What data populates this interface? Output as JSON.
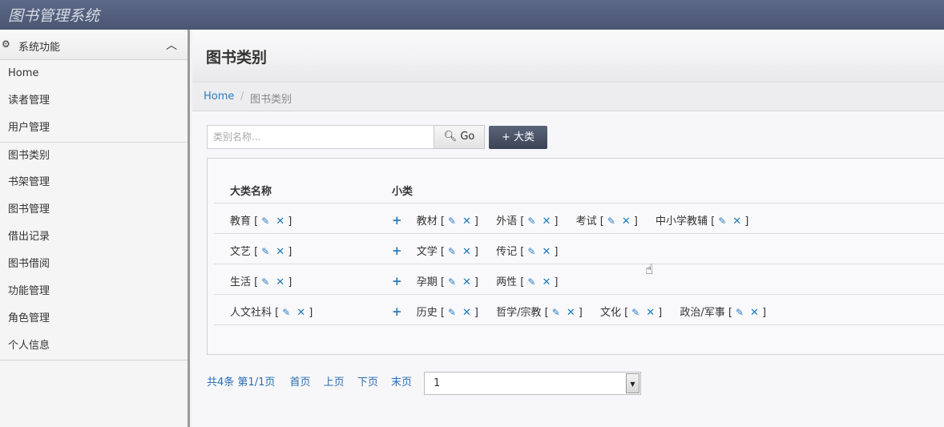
{
  "app": {
    "title": "图书管理系统"
  },
  "sidebar": {
    "section_title": "系统功能",
    "items": [
      {
        "label": "Home"
      },
      {
        "label": "读者管理"
      },
      {
        "label": "用户管理"
      },
      {
        "label": "图书类别"
      },
      {
        "label": "书架管理"
      },
      {
        "label": "图书管理"
      },
      {
        "label": "借出记录"
      },
      {
        "label": "图书借阅"
      },
      {
        "label": "功能管理"
      },
      {
        "label": "角色管理"
      },
      {
        "label": "个人信息"
      }
    ]
  },
  "page": {
    "title": "图书类别"
  },
  "breadcrumb": {
    "home": "Home",
    "separator": "/",
    "current": "图书类别"
  },
  "search": {
    "placeholder": "类别名称...",
    "go_label": "Go",
    "add_label": "大类"
  },
  "table": {
    "headers": {
      "category": "大类名称",
      "subcategory": "小类"
    },
    "rows": [
      {
        "category": "教育",
        "subs": [
          "教材",
          "外语",
          "考试",
          "中小学教辅"
        ]
      },
      {
        "category": "文艺",
        "subs": [
          "文学",
          "传记"
        ]
      },
      {
        "category": "生活",
        "subs": [
          "孕期",
          "两性"
        ]
      },
      {
        "category": "人文社科",
        "subs": [
          "历史",
          "哲学/宗教",
          "文化",
          "政治/军事"
        ]
      }
    ]
  },
  "pagination": {
    "total": "共4条",
    "page_info": "第1/1页",
    "first": "首页",
    "prev": "上页",
    "next": "下页",
    "last": "末页",
    "selected_page": "1"
  },
  "colors": {
    "accent": "#2a7bbf",
    "topbar": "#4a5672",
    "add_button": "#3b4356"
  }
}
